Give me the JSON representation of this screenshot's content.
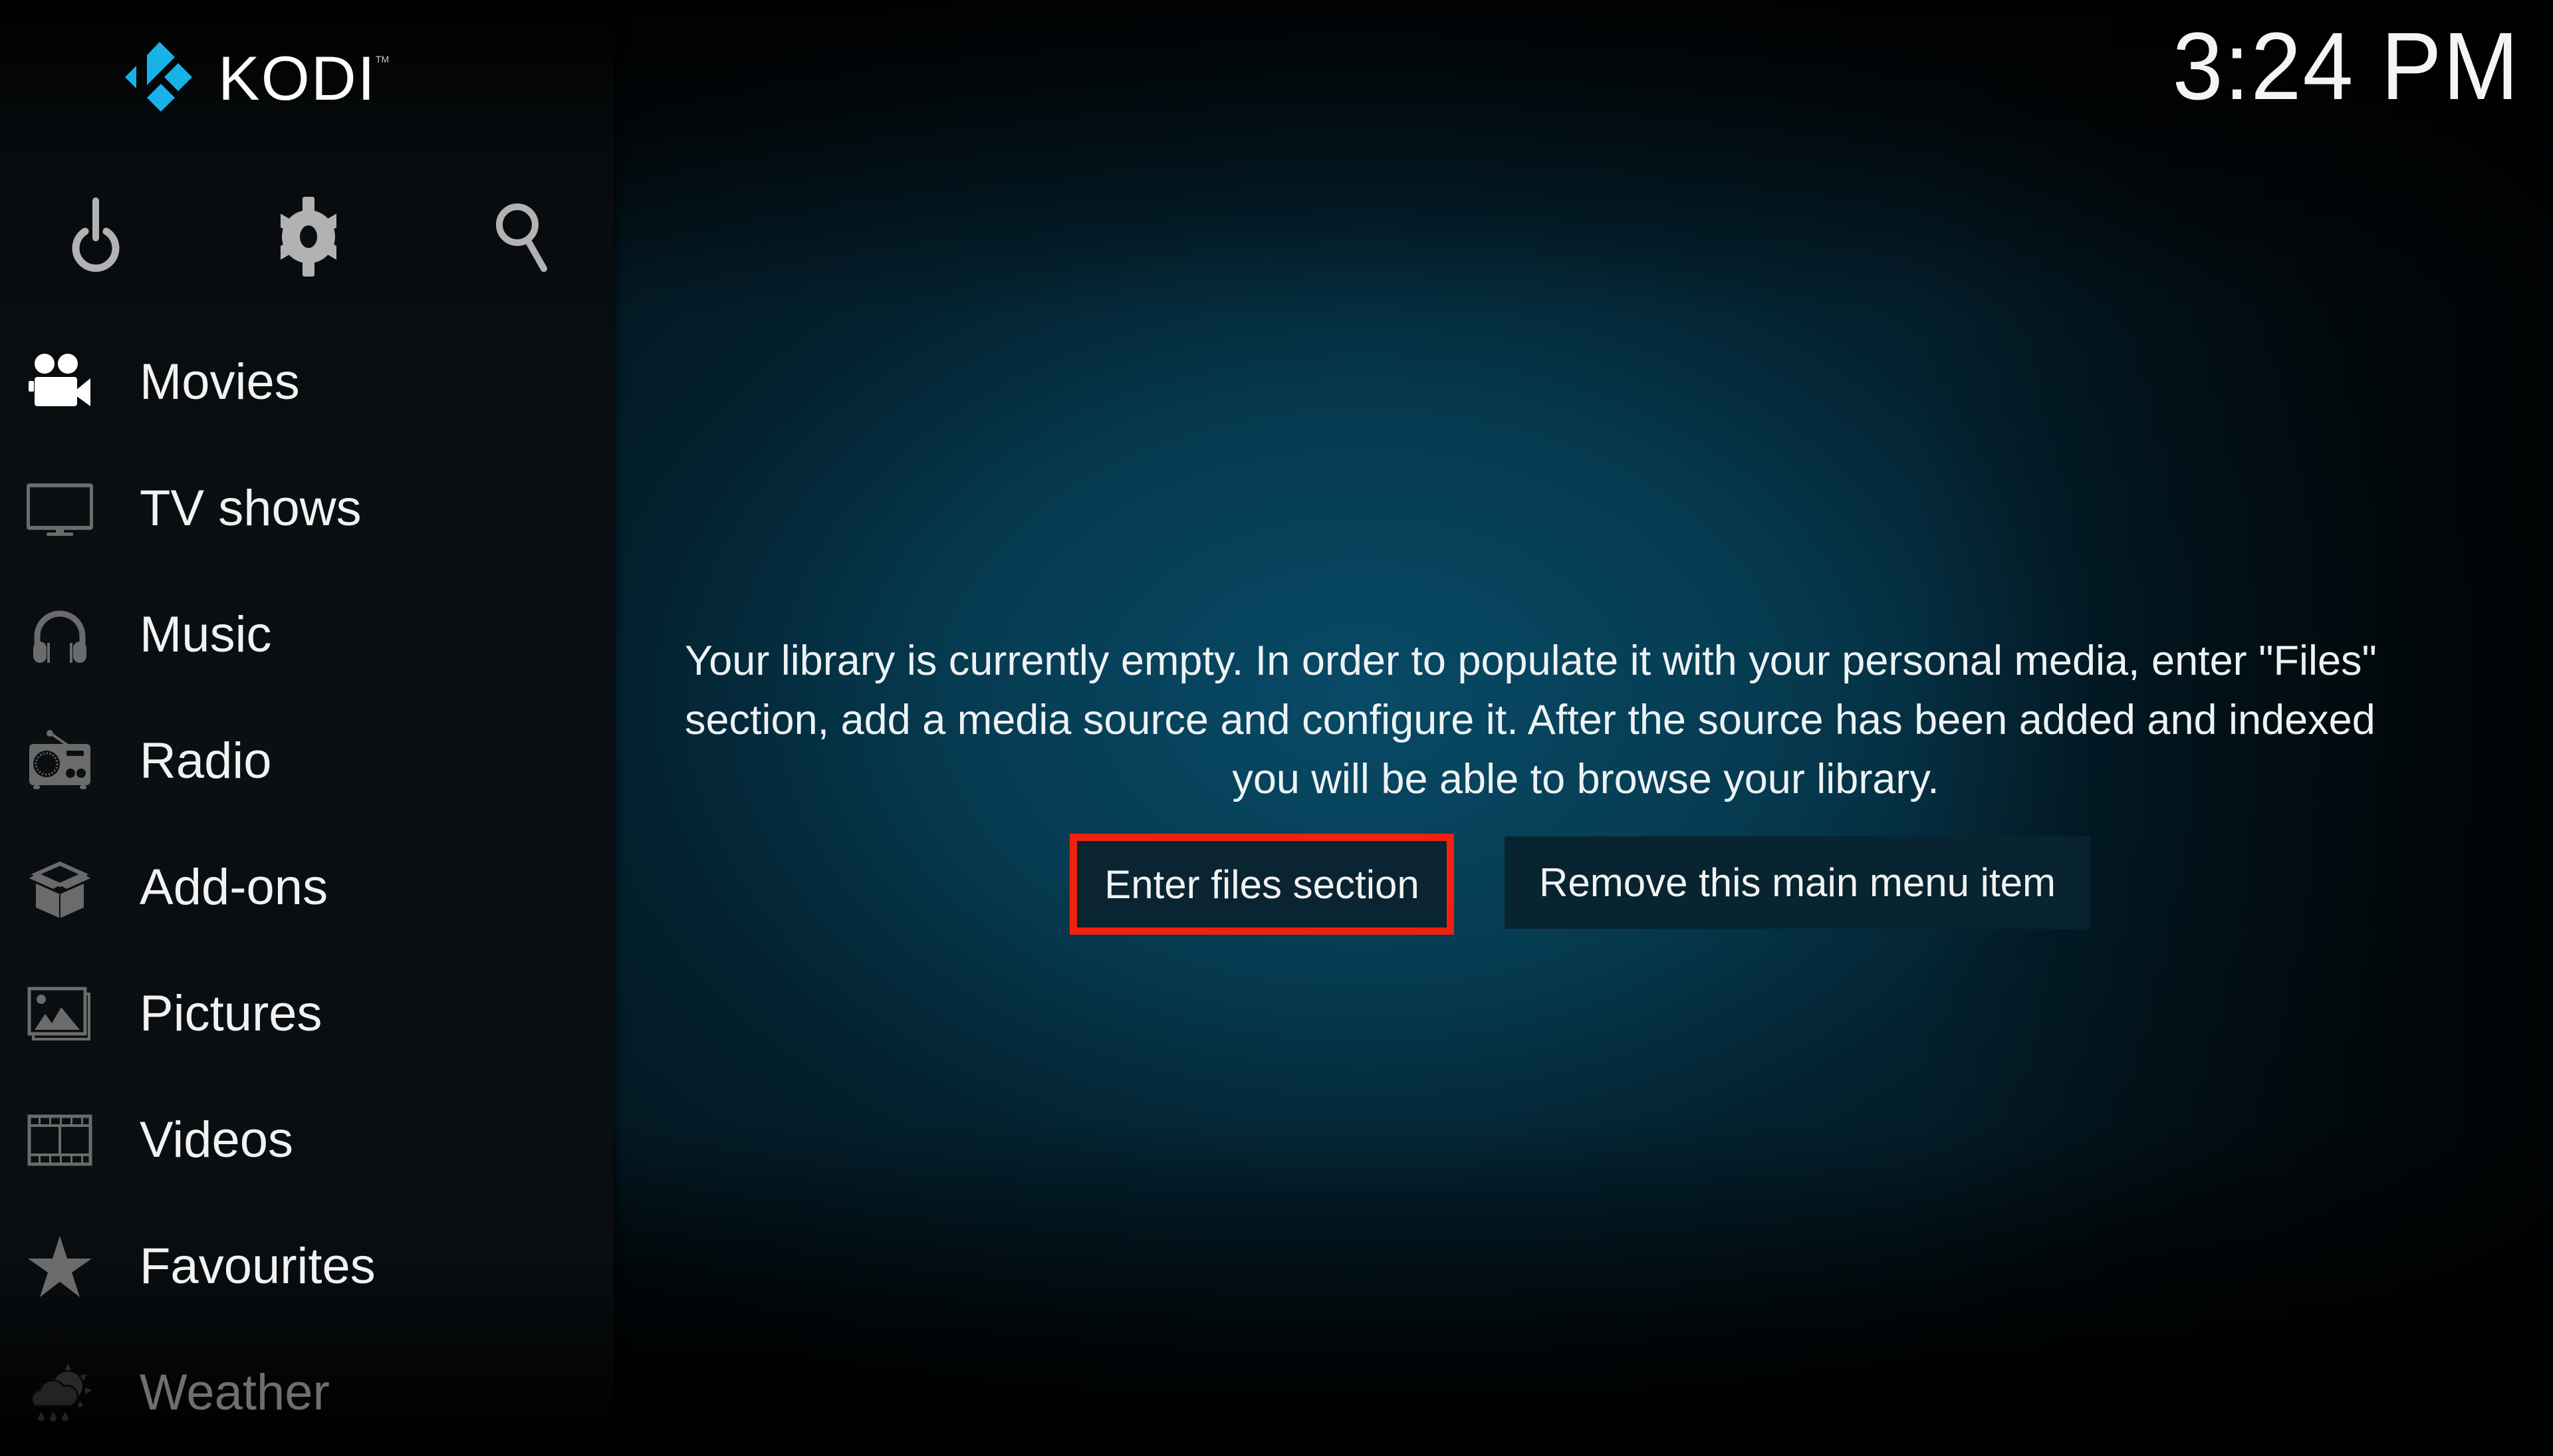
{
  "app": {
    "name": "KODI",
    "trademark": "TM",
    "brand_color": "#17b2e7"
  },
  "clock": "3:24 PM",
  "top_icons": [
    {
      "name": "power",
      "icon": "power-icon"
    },
    {
      "name": "settings",
      "icon": "gear-icon"
    },
    {
      "name": "search",
      "icon": "search-icon"
    }
  ],
  "sidebar": {
    "selected": "Movies",
    "items": [
      {
        "label": "Movies",
        "icon": "movie-camera-icon",
        "selected": true
      },
      {
        "label": "TV shows",
        "icon": "tv-icon",
        "selected": false
      },
      {
        "label": "Music",
        "icon": "headphones-icon",
        "selected": false
      },
      {
        "label": "Radio",
        "icon": "radio-icon",
        "selected": false
      },
      {
        "label": "Add-ons",
        "icon": "box-icon",
        "selected": false
      },
      {
        "label": "Pictures",
        "icon": "pictures-icon",
        "selected": false
      },
      {
        "label": "Videos",
        "icon": "film-icon",
        "selected": false
      },
      {
        "label": "Favourites",
        "icon": "star-icon",
        "selected": false
      },
      {
        "label": "Weather",
        "icon": "weather-icon",
        "selected": false
      }
    ]
  },
  "main": {
    "message_lines": [
      "Your library is currently empty. In order to populate it with your personal media, enter \"Files\"",
      "section, add a media source and configure it. After the source has been added and indexed",
      "you will be able to browse your library."
    ],
    "buttons": {
      "enter_files": "Enter files section",
      "remove_item": "Remove this main menu item"
    },
    "focused_button": "Enter files section",
    "focus_color": "#f0210f"
  }
}
